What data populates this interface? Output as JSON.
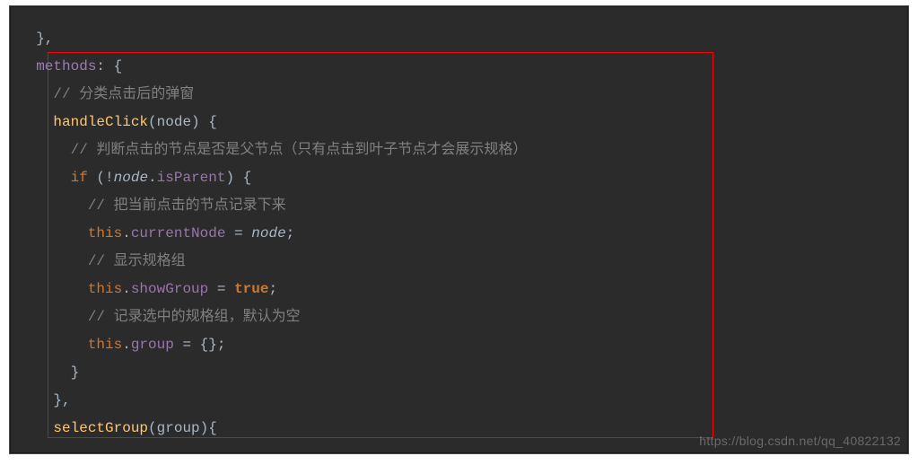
{
  "line0_close": "},",
  "methods_label": "methods",
  "colon_brace": ": {",
  "cmt1": "// 分类点击后的弹窗",
  "fn1_name": "handleClick",
  "fn1_param": "node",
  "open_paren": "(",
  "close_paren": ")",
  "space_brace": " {",
  "cmt2": "// 判断点击的节点是否是父节点（只有点击到叶子节点才会展示规格）",
  "kw_if": "if",
  "space": " ",
  "bang": "!",
  "dot": ".",
  "prop_isParent": "isParent",
  "cmt3": "// 把当前点击的节点记录下来",
  "kw_this": "this",
  "prop_currentNode": "currentNode",
  "eq": " = ",
  "semi": ";",
  "var_node": "node",
  "cmt4": "// 显示规格组",
  "prop_showGroup": "showGroup",
  "bool_true": "true",
  "cmt5": "// 记录选中的规格组，默认为空",
  "prop_group": "group",
  "empty_obj": " = {}",
  "brace_close": "}",
  "brace_close_comma": "},",
  "fn2_name": "selectGroup",
  "fn2_param": "group",
  "fn2_tail": "){",
  "watermark": "https://blog.csdn.net/qq_40822132"
}
